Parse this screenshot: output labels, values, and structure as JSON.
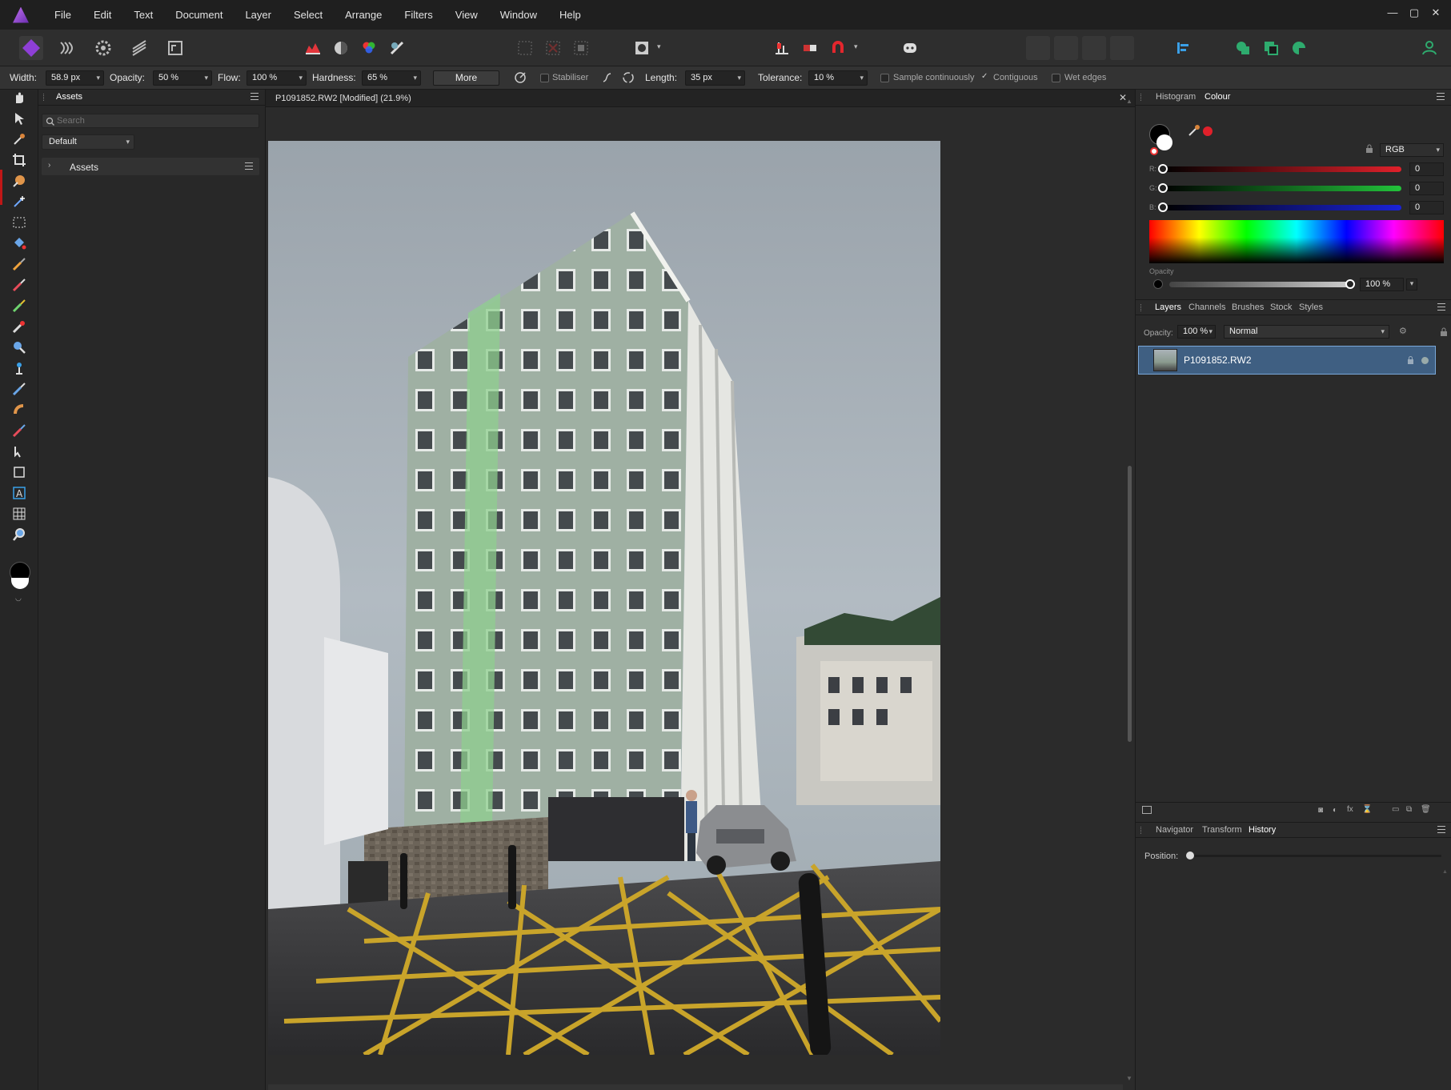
{
  "menu": [
    "File",
    "Edit",
    "Text",
    "Document",
    "Layer",
    "Select",
    "Arrange",
    "Filters",
    "View",
    "Window",
    "Help"
  ],
  "context_bar": {
    "width_label": "Width:",
    "width_value": "58.9 px",
    "opacity_label": "Opacity:",
    "opacity_value": "50 %",
    "flow_label": "Flow:",
    "flow_value": "100 %",
    "hardness_label": "Hardness:",
    "hardness_value": "65 %",
    "more_label": "More",
    "stabiliser_label": "Stabiliser",
    "length_label": "Length:",
    "length_value": "35 px",
    "tolerance_label": "Tolerance:",
    "tolerance_value": "10 %",
    "sample_label": "Sample continuously",
    "contiguous_label": "Contiguous",
    "wet_edges_label": "Wet edges"
  },
  "assets_panel": {
    "tab": "Assets",
    "search_placeholder": "Search",
    "category_select": "Default",
    "section_label": "Assets"
  },
  "document": {
    "tab_title": "P1091852.RW2 [Modified] (21.9%)"
  },
  "colour_panel": {
    "tabs": [
      "Histogram",
      "Colour"
    ],
    "model": "RGB",
    "r_label": "R:",
    "g_label": "G:",
    "b_label": "B:",
    "r_value": "0",
    "g_value": "0",
    "b_value": "0",
    "opacity_label": "Opacity",
    "opacity_value": "100 %",
    "accent_colors": {
      "red": "#e0202a",
      "green": "#22c23a",
      "blue": "#1a22d8"
    }
  },
  "layers_panel": {
    "tabs": [
      "Layers",
      "Channels",
      "Brushes",
      "Stock",
      "Styles"
    ],
    "opacity_label": "Opacity:",
    "opacity_value": "100 %",
    "blend_mode": "Normal",
    "layers": [
      {
        "name": "P1091852.RW2",
        "selected": true
      }
    ]
  },
  "history_panel": {
    "tabs": [
      "Navigator",
      "Transform",
      "History"
    ],
    "position_label": "Position:"
  },
  "colors": {
    "selection": "#3f5f82",
    "accent_purple": "#9b48e0"
  }
}
